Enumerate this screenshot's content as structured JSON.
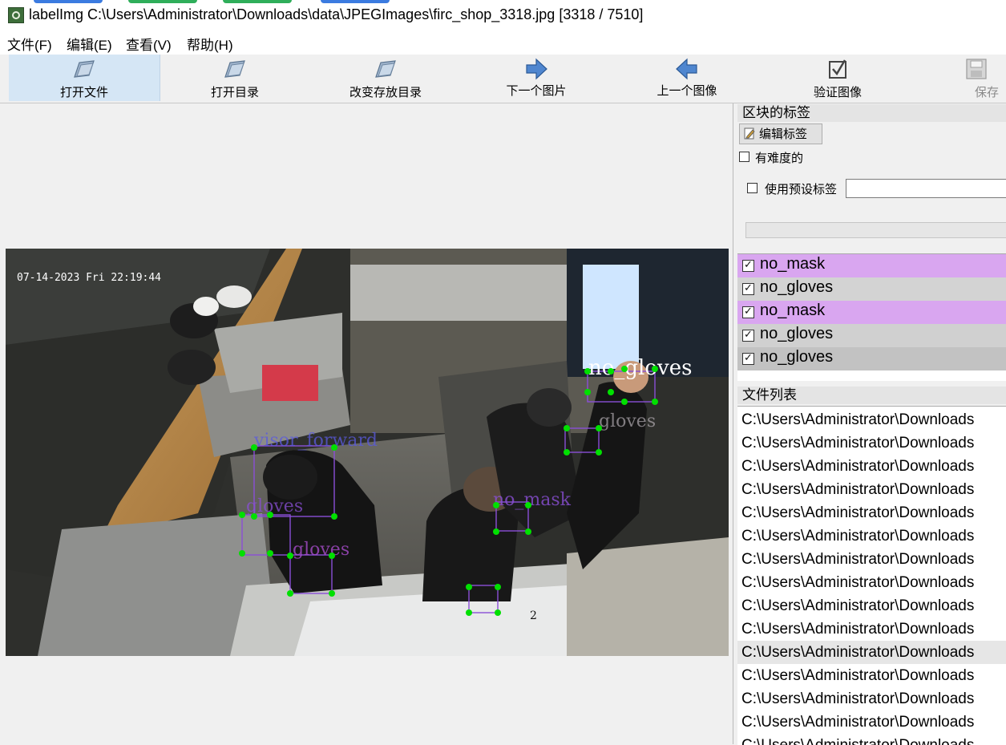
{
  "window": {
    "title": "labelImg C:\\Users\\Administrator\\Downloads\\data\\JPEGImages\\firc_shop_3318.jpg [3318 / 7510]"
  },
  "menu": [
    "文件(F)",
    "编辑(E)",
    "查看(V)",
    "帮助(H)"
  ],
  "toolbar": [
    {
      "label": "打开文件",
      "icon": "open-file-icon"
    },
    {
      "label": "打开目录",
      "icon": "open-dir-icon"
    },
    {
      "label": "改变存放目录",
      "icon": "change-save-dir-icon"
    },
    {
      "label": "下一个图片",
      "icon": "next-image-icon"
    },
    {
      "label": "上一个图像",
      "icon": "prev-image-icon"
    },
    {
      "label": "验证图像",
      "icon": "verify-image-icon"
    },
    {
      "label": "保存",
      "icon": "save-icon"
    }
  ],
  "image": {
    "timestamp": "07-14-2023 Fri 22:19:44",
    "overlay_texts": [
      "no_gloves",
      "visor_forward",
      "gloves",
      "gloves",
      "no_mask",
      "gloves",
      "2"
    ]
  },
  "labels_dock": {
    "title": "区块的标签",
    "edit_button": "编辑标签",
    "difficult_label": "有难度的",
    "use_default_label": "使用预设标签",
    "default_label_value": "",
    "items": [
      {
        "text": "no_mask",
        "checked": true,
        "color": "#d9a6f0"
      },
      {
        "text": "no_gloves",
        "checked": true,
        "color": "#d3d3d3"
      },
      {
        "text": "no_mask",
        "checked": true,
        "color": "#d9a6f0"
      },
      {
        "text": "no_gloves",
        "checked": true,
        "color": "#d0d0d0"
      },
      {
        "text": "no_gloves",
        "checked": true,
        "color": "#c2c2c2"
      }
    ]
  },
  "file_dock": {
    "title": "文件列表",
    "files": [
      "C:\\Users\\Administrator\\Downloads",
      "C:\\Users\\Administrator\\Downloads",
      "C:\\Users\\Administrator\\Downloads",
      "C:\\Users\\Administrator\\Downloads",
      "C:\\Users\\Administrator\\Downloads",
      "C:\\Users\\Administrator\\Downloads",
      "C:\\Users\\Administrator\\Downloads",
      "C:\\Users\\Administrator\\Downloads",
      "C:\\Users\\Administrator\\Downloads",
      "C:\\Users\\Administrator\\Downloads",
      "C:\\Users\\Administrator\\Downloads",
      "C:\\Users\\Administrator\\Downloads",
      "C:\\Users\\Administrator\\Downloads",
      "C:\\Users\\Administrator\\Downloads",
      "C:\\Users\\Administrator\\Downloads"
    ],
    "selected_index": 10
  },
  "colors": {
    "vertex": "#00e000",
    "box_purple": "#8a4fd6",
    "selection_bg": "#e6e6e6",
    "toolbar_active": "#d5e6f5"
  }
}
